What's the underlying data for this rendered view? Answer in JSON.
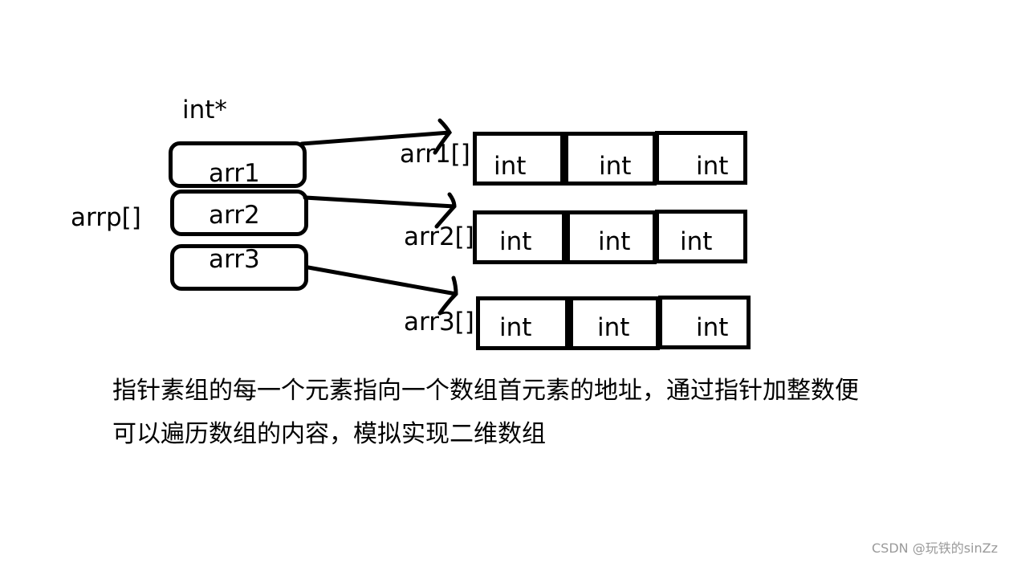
{
  "diagram": {
    "type_label": "int*",
    "array_label": "arrp[]",
    "pointers": [
      {
        "label": "arr1",
        "target": "arr1[]"
      },
      {
        "label": "arr2",
        "target": "arr2[]"
      },
      {
        "label": "arr3",
        "target": "arr3[]"
      }
    ],
    "rows": [
      {
        "label": "arr1[]",
        "cells": [
          "int",
          "int",
          "int"
        ]
      },
      {
        "label": "arr2[]",
        "cells": [
          "int",
          "int",
          "int"
        ]
      },
      {
        "label": "arr3[]",
        "cells": [
          "int",
          "int",
          "int"
        ]
      }
    ],
    "caption_lines": [
      "指针素组的每一个元素指向一个数组首元素的地址，通过指针加整数便",
      "可以遍历数组的内容，模拟实现二维数组"
    ]
  },
  "watermark": "CSDN @玩铁的sinZz"
}
